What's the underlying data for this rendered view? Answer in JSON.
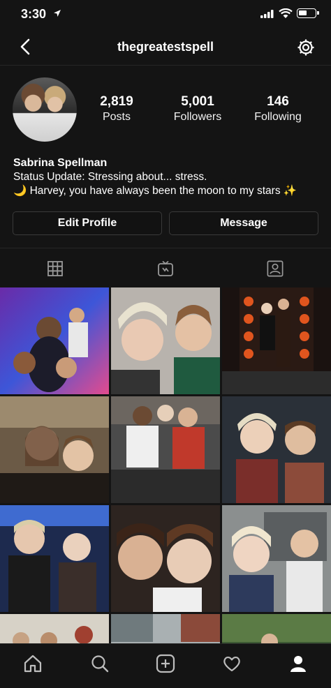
{
  "status_bar": {
    "time": "3:30"
  },
  "header": {
    "username": "thegreatestspell"
  },
  "profile": {
    "stats": [
      {
        "value": "2,819",
        "label": "Posts"
      },
      {
        "value": "5,001",
        "label": "Followers"
      },
      {
        "value": "146",
        "label": "Following"
      }
    ],
    "name": "Sabrina Spellman",
    "bio_line1": "Status Update: Stressing about... stress.",
    "bio_line2": "🌙 Harvey, you have always been the moon to my stars ✨"
  },
  "buttons": {
    "edit_profile": "Edit Profile",
    "message": "Message"
  },
  "tabs": [
    "grid-icon",
    "igtv-icon",
    "tagged-icon"
  ],
  "bottom_nav": [
    "home-icon",
    "search-icon",
    "new-post-icon",
    "activity-heart-icon",
    "profile-icon"
  ],
  "colors": {
    "background": "#141414",
    "divider": "#262626",
    "button_border": "#3a3a3a"
  },
  "posts": [
    {
      "alt": "group selfie purple lights"
    },
    {
      "alt": "two friends selfie"
    },
    {
      "alt": "couple with halloween balloons"
    },
    {
      "alt": "selfie at bar"
    },
    {
      "alt": "group on couch"
    },
    {
      "alt": "selfie with headband"
    },
    {
      "alt": "stadium selfie"
    },
    {
      "alt": "close up smiling selfie"
    },
    {
      "alt": "tongue out selfie"
    },
    {
      "alt": "post 10"
    },
    {
      "alt": "post 11"
    },
    {
      "alt": "post 12"
    }
  ]
}
